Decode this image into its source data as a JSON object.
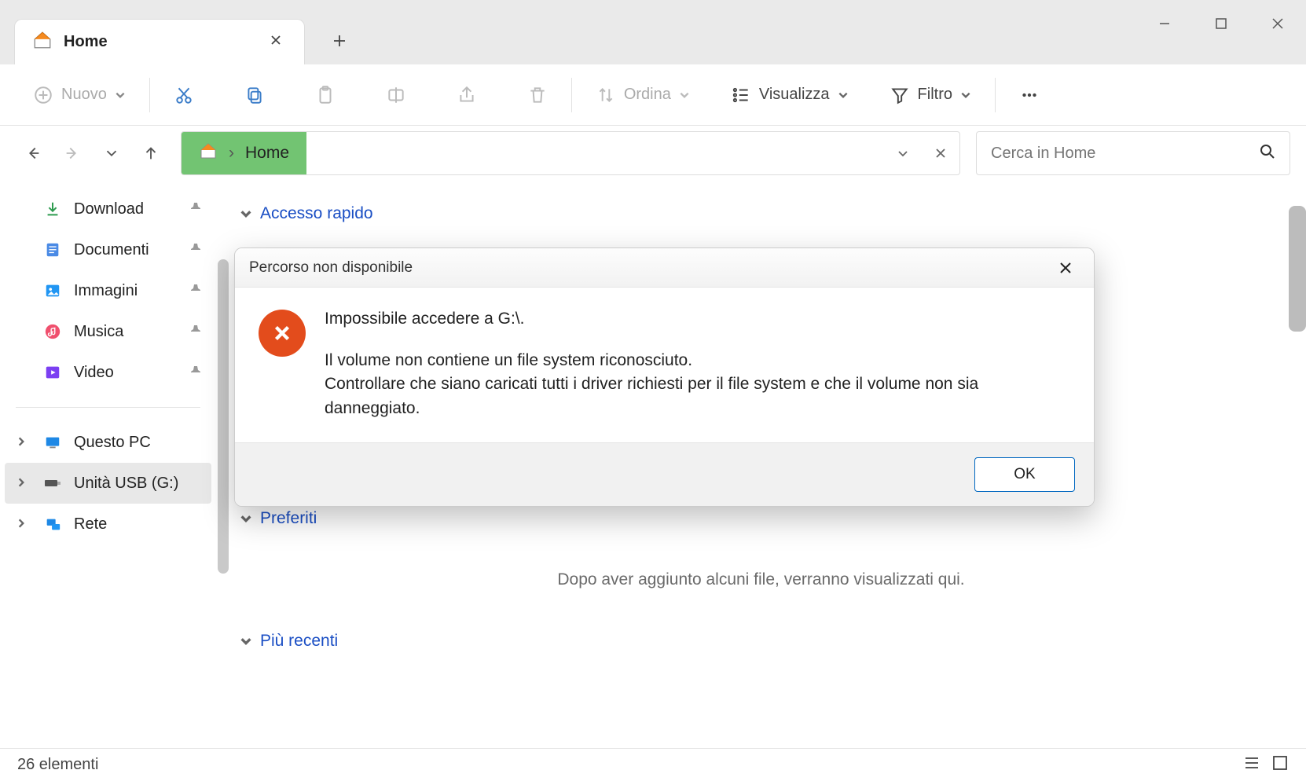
{
  "tab": {
    "title": "Home"
  },
  "toolbar": {
    "new": "Nuovo",
    "sort": "Ordina",
    "view": "Visualizza",
    "filter": "Filtro"
  },
  "breadcrumb": {
    "location": "Home"
  },
  "search": {
    "placeholder": "Cerca in Home"
  },
  "sidebar": {
    "download": "Download",
    "documents": "Documenti",
    "images": "Immagini",
    "music": "Musica",
    "video": "Video",
    "thispc": "Questo PC",
    "usb": "Unità USB (G:)",
    "network": "Rete"
  },
  "content": {
    "quick_access": "Accesso rapido",
    "favorites": "Preferiti",
    "favorites_empty": "Dopo aver aggiunto alcuni file, verranno visualizzati qui.",
    "recent": "Più recenti"
  },
  "status": {
    "items": "26 elementi"
  },
  "dialog": {
    "title": "Percorso non disponibile",
    "heading": "Impossibile accedere a G:\\.",
    "line1": "Il volume non contiene un file system riconosciuto.",
    "line2": "Controllare che siano caricati tutti i driver richiesti per il file system e che il volume non sia danneggiato.",
    "ok": "OK"
  }
}
